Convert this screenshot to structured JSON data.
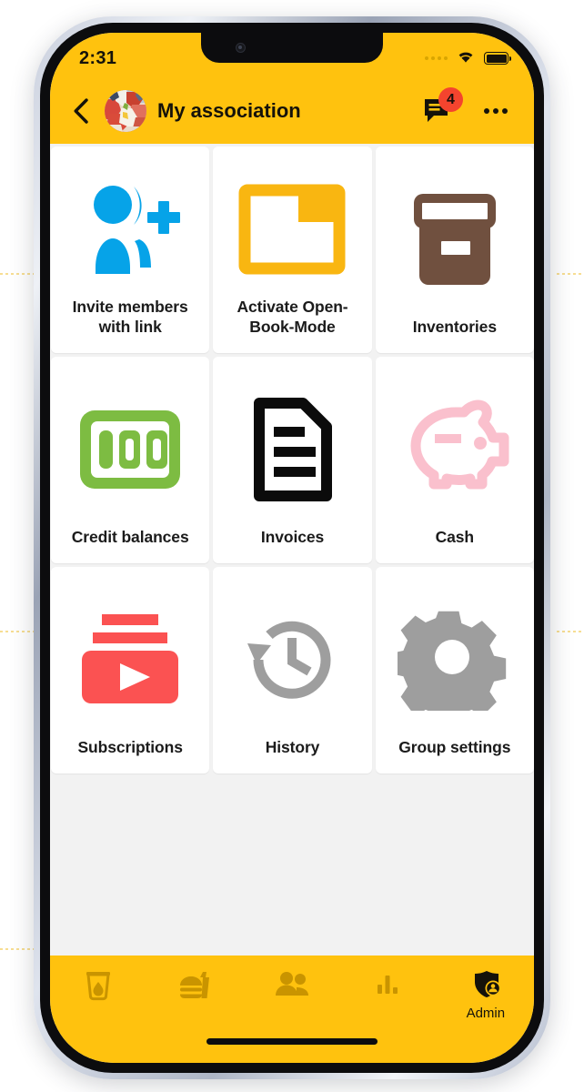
{
  "statusbar": {
    "time": "2:31",
    "signal_icon": "signal-dots-icon",
    "wifi_icon": "wifi-icon",
    "battery_icon": "battery-full-icon"
  },
  "appbar": {
    "back_icon": "back-chevron-icon",
    "avatar_icon": "group-avatar-photo",
    "title": "My association",
    "messages_icon": "chat-bubble-icon",
    "messages_badge": "4",
    "overflow_icon": "more-horizontal-icon"
  },
  "colors": {
    "brand_yellow": "#FFC20E",
    "invite_blue": "#06A3E8",
    "openbook_yellow": "#F9B611",
    "inventories_brown": "#70503F",
    "credit_green": "#7DBC42",
    "invoices_black": "#0B0B0B",
    "cash_pink": "#FAC0CD",
    "subscriptions_red": "#FB5252",
    "history_gray": "#9E9E9E",
    "settings_gray": "#9E9E9E",
    "badge_red": "#F4442E"
  },
  "grid": {
    "tiles": [
      {
        "id": "invite-members-with-link",
        "label": "Invite members with link",
        "icon": "person-add-broadcast-icon"
      },
      {
        "id": "activate-open-book-mode",
        "label": "Activate Open-Book-Mode",
        "icon": "open-folder-icon"
      },
      {
        "id": "inventories",
        "label": "Inventories",
        "icon": "storage-box-icon"
      },
      {
        "id": "credit-balances",
        "label": "Credit balances",
        "icon": "hundred-credits-icon"
      },
      {
        "id": "invoices",
        "label": "Invoices",
        "icon": "document-lines-icon"
      },
      {
        "id": "cash",
        "label": "Cash",
        "icon": "piggy-bank-icon"
      },
      {
        "id": "subscriptions",
        "label": "Subscriptions",
        "icon": "video-play-stack-icon"
      },
      {
        "id": "history",
        "label": "History",
        "icon": "clock-rewind-icon"
      },
      {
        "id": "group-settings",
        "label": "Group settings",
        "icon": "gear-icon"
      }
    ]
  },
  "bottomnav": {
    "items": [
      {
        "id": "drinks",
        "label": "",
        "icon": "drink-glass-icon",
        "active": false
      },
      {
        "id": "food",
        "label": "",
        "icon": "fast-food-icon",
        "active": false
      },
      {
        "id": "members",
        "label": "",
        "icon": "people-icon",
        "active": false
      },
      {
        "id": "stats",
        "label": "",
        "icon": "bar-chart-icon",
        "active": false
      },
      {
        "id": "admin",
        "label": "Admin",
        "icon": "shield-person-icon",
        "active": true
      }
    ]
  }
}
